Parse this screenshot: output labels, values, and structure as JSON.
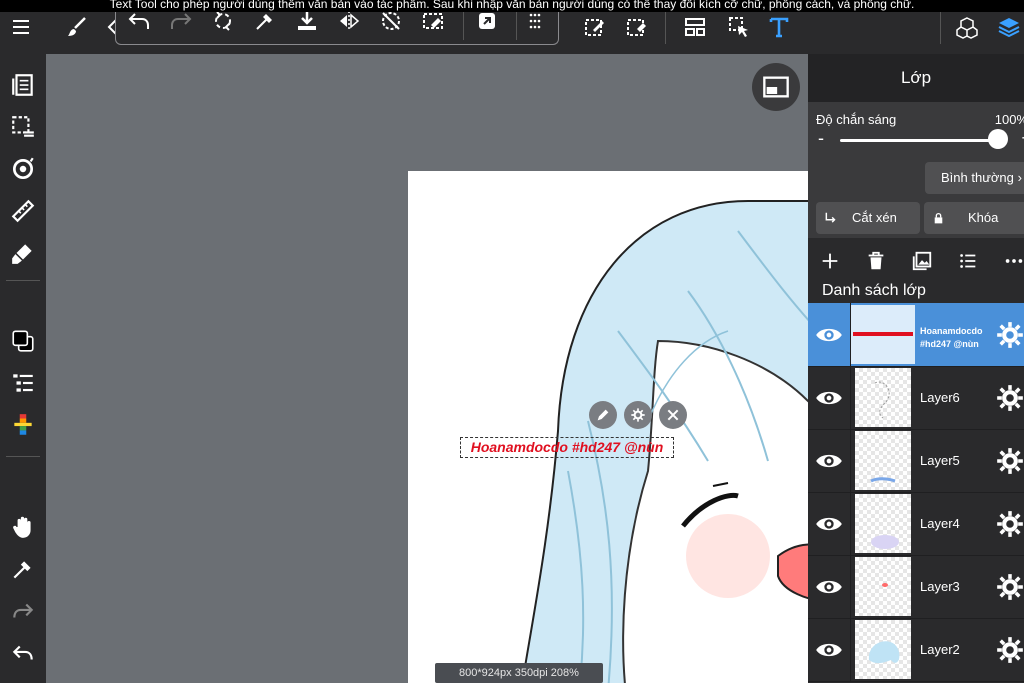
{
  "caption": "Text Tool cho phép người dùng thêm văn bản vào tác phẩm. Sau khi nhập văn bản người dùng có thể thay đổi kích cỡ chữ, phông cách, và phông chữ.",
  "canvas": {
    "text_object": "Hoanamdocdo #hd247 @nùn",
    "info": "800*924px 350dpi 208%"
  },
  "panel": {
    "title": "Lớp",
    "opacity_label": "Độ chắn sáng",
    "opacity_value": "100%",
    "opacity_percent": 100,
    "minus": "-",
    "plus": "+",
    "blend_mode": "Bình thường",
    "clip_label": "Cắt xén",
    "lock_label": "Khóa",
    "list_label": "Danh sách lớp",
    "layers": [
      {
        "name": "Hoanamdocdo #hd247 @nùn",
        "active": true
      },
      {
        "name": "Layer6",
        "active": false
      },
      {
        "name": "Layer5",
        "active": false
      },
      {
        "name": "Layer4",
        "active": false
      },
      {
        "name": "Layer3",
        "active": false
      },
      {
        "name": "Layer2",
        "active": false
      }
    ]
  },
  "colors": {
    "accent": "#4a90d9",
    "text_object": "#e01020",
    "text_tool_icon": "#3aa0ff",
    "canvas_bg": "#6b6f74"
  }
}
